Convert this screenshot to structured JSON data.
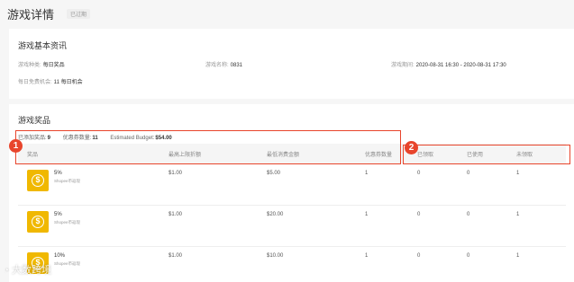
{
  "header": {
    "title": "游戏详情",
    "status": "已过期"
  },
  "basic_info": {
    "title": "游戏基本资讯",
    "fields": [
      {
        "label": "游戏种类:",
        "value": "每日奖品"
      },
      {
        "label": "游戏名称:",
        "value": "0831"
      },
      {
        "label": "游戏期间:",
        "value": "2020-08-31 16:30 - 2020-08-31 17:30"
      },
      {
        "label": "每日免费机会:",
        "value": "11 每日机会"
      }
    ]
  },
  "prizes": {
    "title": "游戏奖品",
    "summary": {
      "added_label": "已添加奖品:",
      "added_value": "9",
      "vouchers_label": "优惠券数量:",
      "vouchers_value": "11",
      "budget_label": "Estimated Budget:",
      "budget_value": "$54.00"
    },
    "columns": [
      "奖品",
      "最高上限折额",
      "最低消费金额",
      "优惠券数量",
      "已领取",
      "已使用",
      "未领取"
    ],
    "rows": [
      {
        "name": "5%",
        "sub": "Shopee币返现",
        "max_discount": "$1.00",
        "min_spend": "$5.00",
        "quantity": "1",
        "claimed": "0",
        "used": "0",
        "unclaimed": "1"
      },
      {
        "name": "5%",
        "sub": "Shopee币返现",
        "max_discount": "$1.00",
        "min_spend": "$20.00",
        "quantity": "1",
        "claimed": "0",
        "used": "0",
        "unclaimed": "1"
      },
      {
        "name": "10%",
        "sub": "Shopee币返现",
        "max_discount": "$1.00",
        "min_spend": "$10.00",
        "quantity": "1",
        "claimed": "0",
        "used": "0",
        "unclaimed": "1"
      }
    ]
  },
  "annotations": {
    "marker1": "1",
    "marker2": "2"
  },
  "watermark": {
    "text": "大数跨境"
  },
  "colors": {
    "highlight": "#e8452c",
    "voucher": "#f0b800"
  },
  "icons": {
    "voucher": "coin-icon",
    "watermark": "weibo-icon"
  }
}
